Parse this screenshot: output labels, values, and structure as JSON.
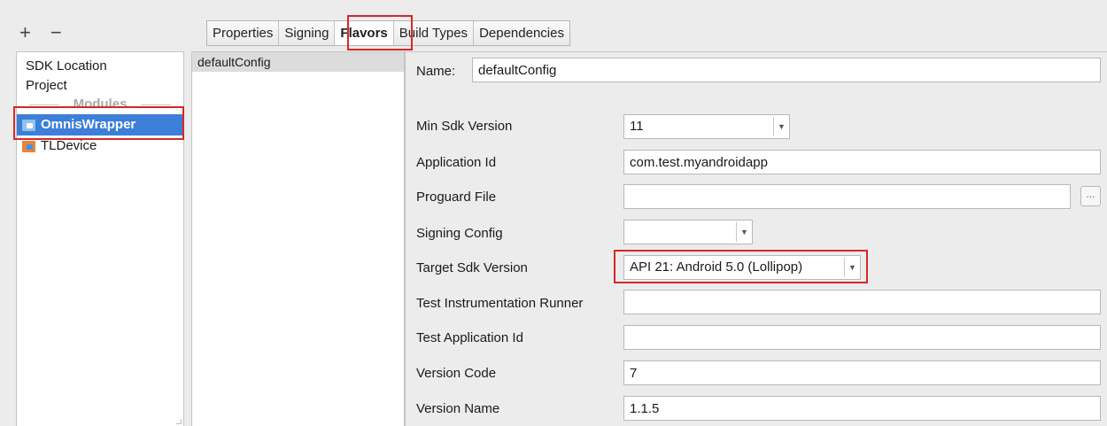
{
  "toolbar": {
    "add_label": "+",
    "remove_label": "−"
  },
  "modules_pane": {
    "items": [
      {
        "label": "SDK Location"
      },
      {
        "label": "Project"
      }
    ],
    "section_label": "Modules",
    "modules": [
      {
        "label": "OmnisWrapper",
        "icon": "module-icon",
        "selected": true
      },
      {
        "label": "TLDevice",
        "icon": "device-module-icon",
        "selected": false
      }
    ]
  },
  "tabs": [
    {
      "label": "Properties"
    },
    {
      "label": "Signing"
    },
    {
      "label": "Flavors",
      "active": true
    },
    {
      "label": "Build Types"
    },
    {
      "label": "Dependencies"
    }
  ],
  "flavors": {
    "items": [
      {
        "label": "defaultConfig"
      }
    ]
  },
  "form": {
    "name_label": "Name:",
    "name_value": "defaultConfig",
    "fields": [
      {
        "label": "Min Sdk Version",
        "value": "11",
        "type": "combo"
      },
      {
        "label": "Application Id",
        "value": "com.test.myandroidapp",
        "type": "text"
      },
      {
        "label": "Proguard File",
        "value": "",
        "type": "file",
        "browse_label": "..."
      },
      {
        "label": "Signing Config",
        "value": "",
        "type": "combo"
      },
      {
        "label": "Target Sdk Version",
        "value": "API 21: Android 5.0 (Lollipop)",
        "type": "combo"
      },
      {
        "label": "Test Instrumentation Runner",
        "value": "",
        "type": "text"
      },
      {
        "label": "Test Application Id",
        "value": "",
        "type": "text"
      },
      {
        "label": "Version Code",
        "value": "7",
        "type": "text"
      },
      {
        "label": "Version Name",
        "value": "1.1.5",
        "type": "text"
      }
    ]
  },
  "colors": {
    "selection": "#3d7fd8",
    "highlight_box": "#d62828",
    "module_icon": "#4a8fd8",
    "device_icon": "#e8843c"
  }
}
